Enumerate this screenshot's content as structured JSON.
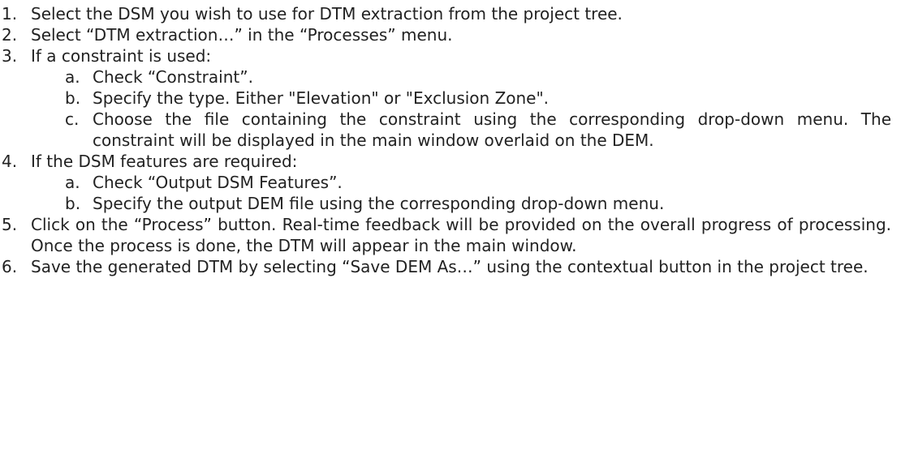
{
  "steps": [
    {
      "num": "1.",
      "text": "Select the DSM you wish to use for DTM extraction from the project tree."
    },
    {
      "num": "2.",
      "text": "Select “DTM extraction…” in the “Processes” menu."
    },
    {
      "num": "3.",
      "text": "If a constraint is used:",
      "sub": [
        {
          "letter": "a.",
          "text": "Check “Constraint”."
        },
        {
          "letter": "b.",
          "text": "Specify the type. Either \"Elevation\" or \"Exclusion Zone\"."
        },
        {
          "letter": "c.",
          "text": "Choose the file containing the constraint using the corresponding drop-down menu. The constraint will be displayed in the main window overlaid on the DEM."
        }
      ]
    },
    {
      "num": "4.",
      "text": "If the DSM features are required:",
      "sub": [
        {
          "letter": "a.",
          "text": "Check “Output DSM Features”."
        },
        {
          "letter": "b.",
          "text": "Specify the output DEM file using the corresponding drop-down menu."
        }
      ]
    },
    {
      "num": "5.",
      "text": "Click on the “Process” button.  Real-time feedback will be provided on the overall progress of processing.  Once the process is done, the DTM will appear in the main window."
    },
    {
      "num": "6.",
      "text": "Save the generated DTM by selecting “Save DEM As…” using the contextual button in the project tree."
    }
  ]
}
